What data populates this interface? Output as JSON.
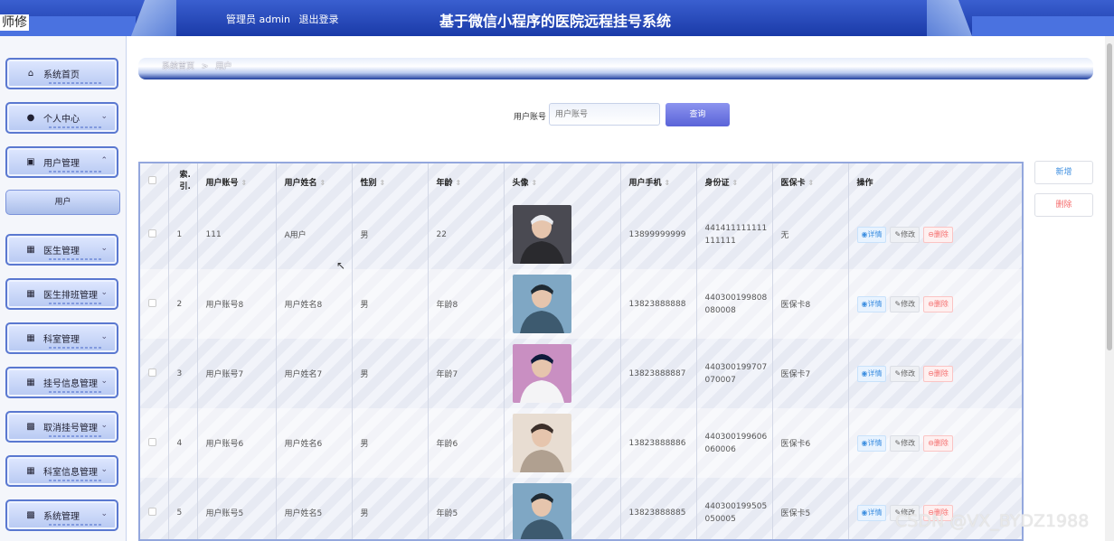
{
  "header": {
    "left_cut_text": "师修",
    "user_label": "管理员 admin",
    "logout_label": "退出登录",
    "title": "基于微信小程序的医院远程挂号系统"
  },
  "sidebar": {
    "items": [
      {
        "label": "系统首页",
        "icon": "home-icon"
      },
      {
        "label": "个人中心",
        "icon": "user-icon"
      },
      {
        "label": "用户管理",
        "icon": "folder-icon",
        "expanded": true
      },
      {
        "label": "医生管理",
        "icon": "grid-icon"
      },
      {
        "label": "医生排班管理",
        "icon": "grid-icon"
      },
      {
        "label": "科室管理",
        "icon": "grid-icon"
      },
      {
        "label": "挂号信息管理",
        "icon": "grid-icon"
      },
      {
        "label": "取消挂号管理",
        "icon": "briefcase-icon"
      },
      {
        "label": "科室信息管理",
        "icon": "grid-icon"
      },
      {
        "label": "系统管理",
        "icon": "book-icon"
      }
    ],
    "submenu_label": "用户"
  },
  "breadcrumb": {
    "home": "系统首页",
    "separator": ">",
    "current": "用户"
  },
  "search": {
    "label": "用户账号",
    "placeholder": "用户账号",
    "button": "查询"
  },
  "actions": {
    "add": "新增",
    "delete": "删除"
  },
  "table": {
    "headers": [
      "索引",
      "用户账号",
      "用户姓名",
      "性别",
      "年龄",
      "头像",
      "用户手机",
      "身份证",
      "医保卡",
      "操作"
    ],
    "index_header_lines": [
      "索",
      "引"
    ],
    "rows": [
      {
        "index": "1",
        "account": "111",
        "name": "A用户",
        "gender": "男",
        "age": "22",
        "phone": "13899999999",
        "id_line1": "441411111111",
        "id_line2": "111111",
        "card": "无"
      },
      {
        "index": "2",
        "account": "用户账号8",
        "name": "用户姓名8",
        "gender": "男",
        "age": "年龄8",
        "phone": "13823888888",
        "id_line1": "440300199808",
        "id_line2": "080008",
        "card": "医保卡8"
      },
      {
        "index": "3",
        "account": "用户账号7",
        "name": "用户姓名7",
        "gender": "男",
        "age": "年龄7",
        "phone": "13823888887",
        "id_line1": "440300199707",
        "id_line2": "070007",
        "card": "医保卡7"
      },
      {
        "index": "4",
        "account": "用户账号6",
        "name": "用户姓名6",
        "gender": "男",
        "age": "年龄6",
        "phone": "13823888886",
        "id_line1": "440300199606",
        "id_line2": "060006",
        "card": "医保卡6"
      },
      {
        "index": "5",
        "account": "用户账号5",
        "name": "用户姓名5",
        "gender": "男",
        "age": "年龄5",
        "phone": "13823888885",
        "id_line1": "440300199505",
        "id_line2": "050005",
        "card": "医保卡5"
      }
    ],
    "op_detail": "详情",
    "op_edit": "修改",
    "op_delete": "删除"
  },
  "watermark": "CSDN @VX_BYDZ1988"
}
